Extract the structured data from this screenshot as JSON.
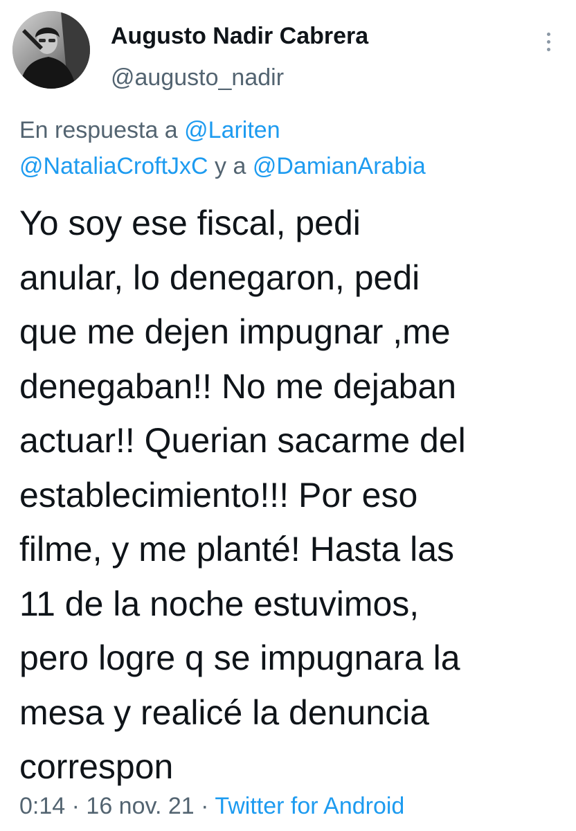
{
  "author": {
    "display_name": "Augusto Nadir Cabrera",
    "handle": "@augusto_nadir",
    "avatar_icon": "profile-photo"
  },
  "more_icon": "more-vertical-icon",
  "reply_context": {
    "prefix": "En respuesta a",
    "mention_1": "@Lariten",
    "mention_2": "@NataliaCroftJxC",
    "connector": "y a",
    "mention_3": "@DamianArabia"
  },
  "tweet": {
    "lines": [
      "Yo soy ese fiscal, pedi",
      "anular, lo denegaron, pedi",
      "que me dejen impugnar ,me",
      "denegaban!! No me dejaban",
      "actuar!! Querian sacarme del",
      "establecimiento!!! Por eso",
      "filme, y me planté! Hasta las",
      "11 de la noche estuvimos,",
      "pero logre q se impugnara la",
      "mesa y realicé la denuncia",
      "correspon"
    ]
  },
  "meta": {
    "time": "0:14",
    "separator": "·",
    "date": "16 nov. 21",
    "source": "Twitter for Android"
  },
  "colors": {
    "text": "#0f1419",
    "secondary": "#536471",
    "link": "#1d9bf0"
  }
}
